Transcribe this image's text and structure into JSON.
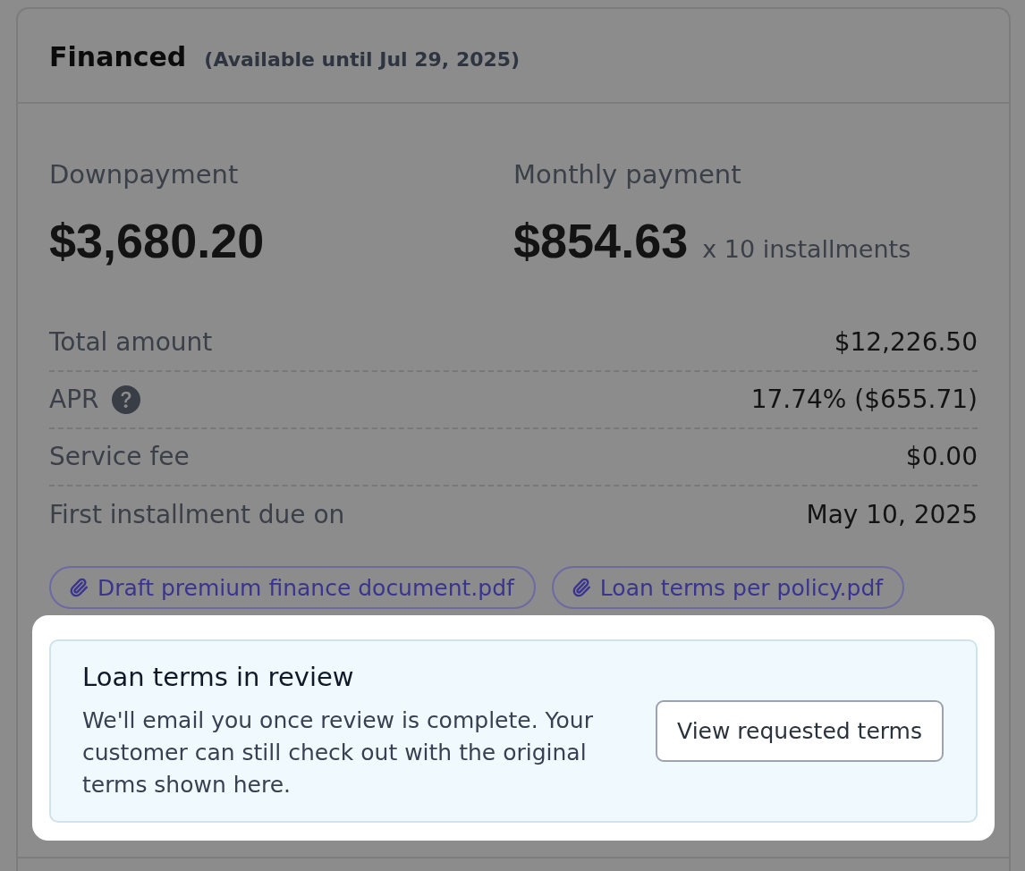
{
  "card": {
    "title": "Financed",
    "availability": "(Available until Jul 29, 2025)"
  },
  "payments": [
    {
      "label": "Downpayment",
      "amount": "$3,680.20"
    },
    {
      "label": "Monthly payment",
      "amount": "$854.63",
      "suffix": "x 10 installments"
    }
  ],
  "details": [
    {
      "label": "Total amount",
      "value": "$12,226.50",
      "help": false
    },
    {
      "label": "APR",
      "value": "17.74% ($655.71)",
      "help": true
    },
    {
      "label": "Service fee",
      "value": "$0.00",
      "help": false
    },
    {
      "label": "First installment due on",
      "value": "May 10, 2025",
      "help": false
    }
  ],
  "attachments": [
    {
      "name": "Draft premium finance document.pdf"
    },
    {
      "name": "Loan terms per policy.pdf"
    }
  ],
  "notice": {
    "highlighted": true,
    "title": "Loan terms in review",
    "message": "We'll email you once review is complete. Your customer can still check out with the original terms shown here.",
    "button": "View requested terms"
  }
}
